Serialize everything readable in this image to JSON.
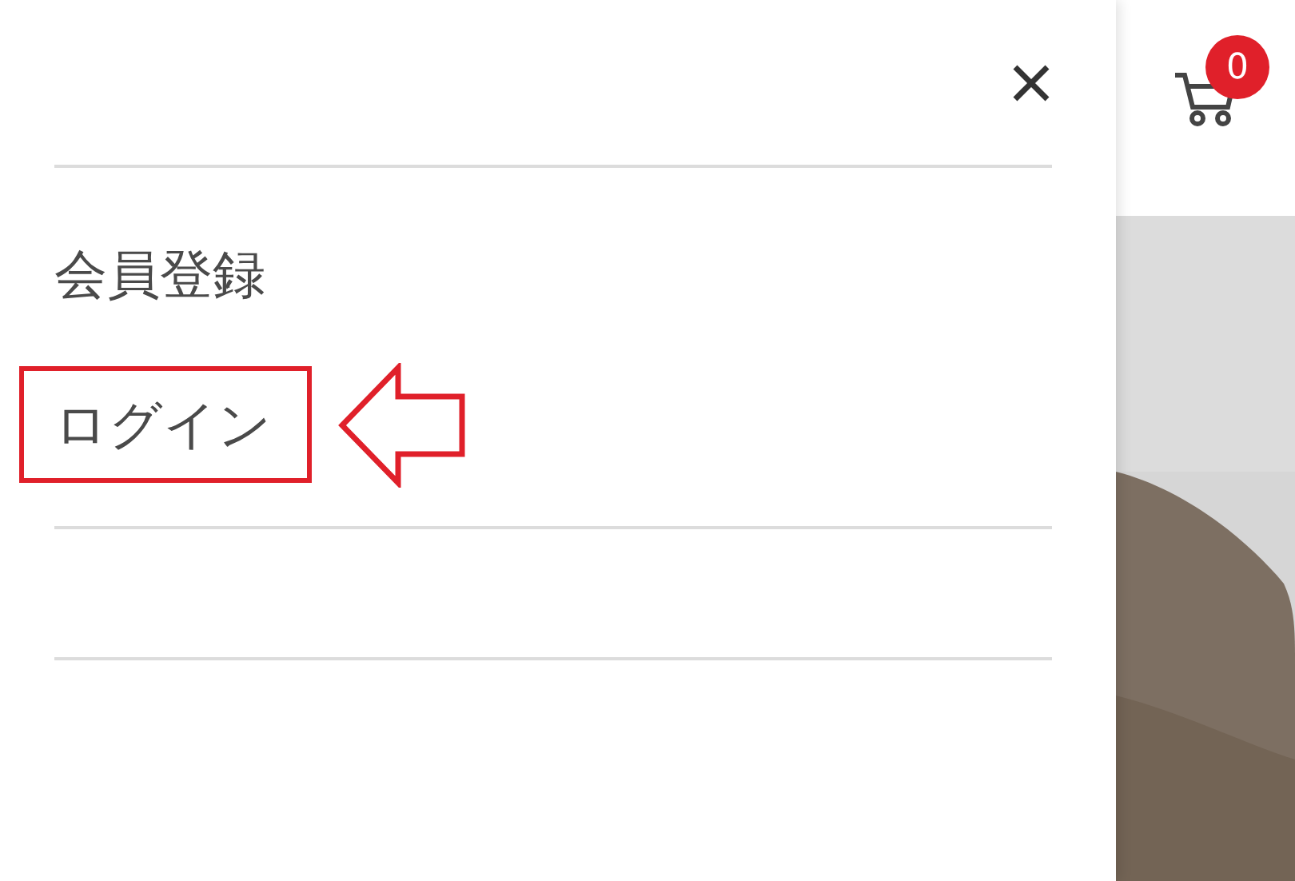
{
  "drawer": {
    "menu_items": [
      {
        "label": "会員登録",
        "highlighted": false
      },
      {
        "label": "ログイン",
        "highlighted": true
      }
    ]
  },
  "header": {
    "cart": {
      "count": "0"
    }
  }
}
